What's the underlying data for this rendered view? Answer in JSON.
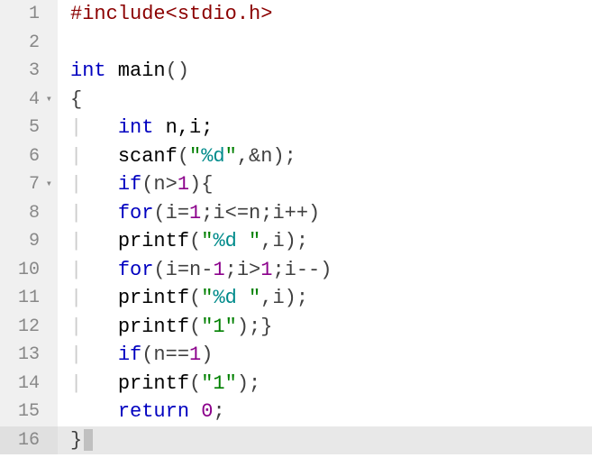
{
  "gutter": {
    "l1": "1",
    "l2": "2",
    "l3": "3",
    "l4": "4",
    "l5": "5",
    "l6": "6",
    "l7": "7",
    "l8": "8",
    "l9": "9",
    "l10": "10",
    "l11": "11",
    "l12": "12",
    "l13": "13",
    "l14": "14",
    "l15": "15",
    "l16": "16",
    "fold": "▾"
  },
  "code": {
    "indent1": "    ",
    "indent2": "|   ",
    "l1_directive": "#include",
    "l1_lt": "<",
    "l1_header": "stdio.h",
    "l1_gt": ">",
    "l3_int": "int",
    "l3_main": " main",
    "l3_paren": "()",
    "l4_brace": "{",
    "l5_int": "int",
    "l5_rest": " n,i;",
    "l6_fn": "scanf",
    "l6_open": "(",
    "l6_str1": "\"",
    "l6_fmt": "%d",
    "l6_str2": "\"",
    "l6_rest": ",&n);",
    "l7_if": "if",
    "l7_open": "(n>",
    "l7_num": "1",
    "l7_close": "){",
    "l8_for": "for",
    "l8_a": "(i=",
    "l8_n1": "1",
    "l8_b": ";i<=n;i++)",
    "l9_fn": "printf",
    "l9_open": "(",
    "l9_s1": "\"",
    "l9_fmt": "%d",
    "l9_s2": " \"",
    "l9_rest": ",i);",
    "l10_for": "for",
    "l10_a": "(i=n-",
    "l10_n1": "1",
    "l10_b": ";i>",
    "l10_n2": "1",
    "l10_c": ";i--)",
    "l11_fn": "printf",
    "l11_open": "(",
    "l11_s1": "\"",
    "l11_fmt": "%d",
    "l11_s2": " \"",
    "l11_rest": ",i);",
    "l12_fn": "printf",
    "l12_open": "(",
    "l12_str": "\"1\"",
    "l12_close": ");}",
    "l13_if": "if",
    "l13_open": "(n==",
    "l13_num": "1",
    "l13_close": ")",
    "l14_fn": "printf",
    "l14_open": "(",
    "l14_str": "\"1\"",
    "l14_close": ");",
    "l15_return": "return",
    "l15_sp": " ",
    "l15_num": "0",
    "l15_semi": ";",
    "l16_brace": "}"
  },
  "chart_data": {
    "type": "table",
    "title": "C source code listing",
    "lines": [
      {
        "n": 1,
        "text": "#include<stdio.h>"
      },
      {
        "n": 2,
        "text": ""
      },
      {
        "n": 3,
        "text": "int main()"
      },
      {
        "n": 4,
        "text": "{",
        "fold": true
      },
      {
        "n": 5,
        "text": "    int n,i;"
      },
      {
        "n": 6,
        "text": "    scanf(\"%d\",&n);"
      },
      {
        "n": 7,
        "text": "    if(n>1){",
        "fold": true
      },
      {
        "n": 8,
        "text": "    for(i=1;i<=n;i++)"
      },
      {
        "n": 9,
        "text": "    printf(\"%d \",i);"
      },
      {
        "n": 10,
        "text": "    for(i=n-1;i>1;i--)"
      },
      {
        "n": 11,
        "text": "    printf(\"%d \",i);"
      },
      {
        "n": 12,
        "text": "    printf(\"1\");}"
      },
      {
        "n": 13,
        "text": "    if(n==1)"
      },
      {
        "n": 14,
        "text": "    printf(\"1\");"
      },
      {
        "n": 15,
        "text": "    return 0;"
      },
      {
        "n": 16,
        "text": "}",
        "highlighted": true
      }
    ]
  }
}
